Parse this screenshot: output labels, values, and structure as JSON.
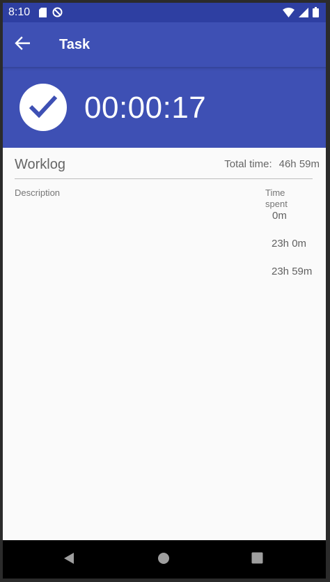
{
  "status_bar": {
    "time": "8:10",
    "icons": [
      "sd-card-icon",
      "do-not-disturb-icon",
      "wifi-icon",
      "signal-icon",
      "battery-icon"
    ]
  },
  "app_bar": {
    "title": "Task",
    "back_icon": "arrow-back-icon"
  },
  "timer": {
    "value": "00:00:17",
    "check_icon": "check-circle-icon"
  },
  "worklog": {
    "title": "Worklog",
    "total_label": "Total time:",
    "total_value": "46h 59m",
    "columns": {
      "description": "Description",
      "time_spent": "Time spent"
    },
    "entries": [
      {
        "description": "",
        "time": "0m"
      },
      {
        "description": "",
        "time": "23h 0m"
      },
      {
        "description": "",
        "time": "23h 59m"
      }
    ]
  },
  "nav_bar": {
    "icons": [
      "back-triangle-icon",
      "home-circle-icon",
      "recents-square-icon"
    ]
  },
  "colors": {
    "primary": "#3e50b4",
    "primary_dark": "#2e3fa2",
    "background": "#fafafa"
  }
}
